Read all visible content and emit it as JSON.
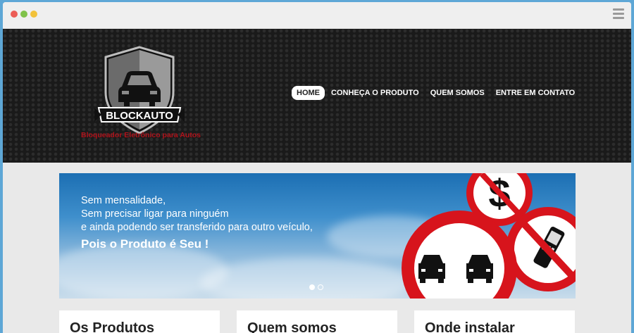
{
  "brand": {
    "name": "BLOCKAUTO",
    "tagline": "Bloqueador Eletrônico para Autos"
  },
  "nav": {
    "items": [
      {
        "label": "HOME",
        "active": true
      },
      {
        "label": "CONHEÇA O PRODUTO",
        "active": false
      },
      {
        "label": "QUEM SOMOS",
        "active": false
      },
      {
        "label": "ENTRE EM CONTATO",
        "active": false
      }
    ]
  },
  "hero": {
    "lines": [
      "Sem mensalidade,",
      "Sem precisar ligar para ninguém",
      "e ainda podendo ser transferido para outro veículo,"
    ],
    "highlight": "Pois o Produto é Seu !",
    "slides": 2,
    "active_slide": 1
  },
  "cards": [
    {
      "title": "Os Produtos"
    },
    {
      "title": "Quem somos"
    },
    {
      "title": "Onde instalar"
    }
  ],
  "colors": {
    "tagline": "#b0121a",
    "sign_red": "#d7141c",
    "header_bg": "#1a1a1a"
  }
}
